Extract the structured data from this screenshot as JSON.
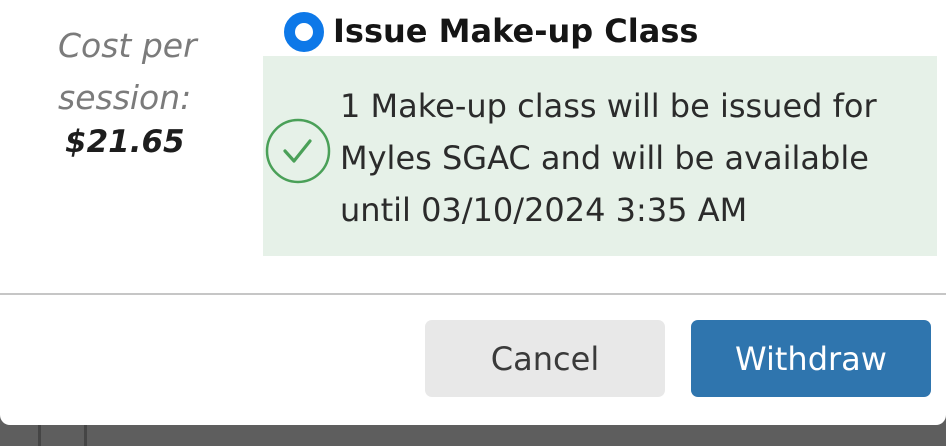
{
  "cost": {
    "label": "Cost per session:",
    "value": "$21.65"
  },
  "option": {
    "label": "Issue Make-up Class",
    "selected": true
  },
  "notice": {
    "icon": "check-circle-icon",
    "message": "1 Make-up class will be issued for Myles SGAC and will be available until 03/10/2024 3:35 AM"
  },
  "actions": {
    "cancel_label": "Cancel",
    "withdraw_label": "Withdraw"
  },
  "colors": {
    "radio_accent": "#0d78e8",
    "notice_background": "#e6f1e8",
    "check_icon": "#4aa058",
    "primary_button": "#2f75ae",
    "secondary_button": "#e8e8e8"
  }
}
